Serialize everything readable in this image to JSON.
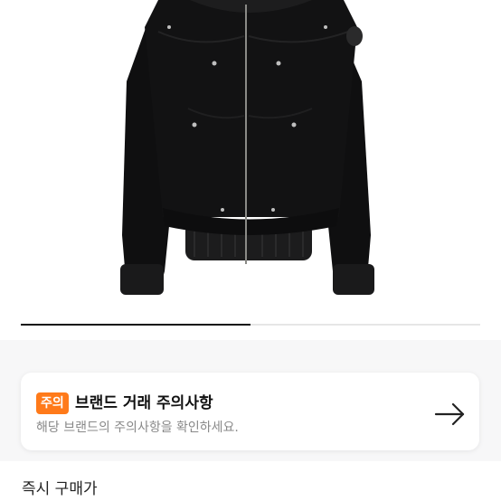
{
  "product": {
    "image_alt": "black bomber jacket",
    "carousel_progress": 0.5
  },
  "notice": {
    "badge": "주의",
    "title": "브랜드 거래 주의사항",
    "subtitle": "해당 브랜드의 주의사항을 확인하세요.",
    "arrow_icon": "arrow-right-icon"
  },
  "price": {
    "label": "즉시 구매가"
  },
  "colors": {
    "accent": "#ff7a1a",
    "background_section": "#f7f7f8"
  }
}
